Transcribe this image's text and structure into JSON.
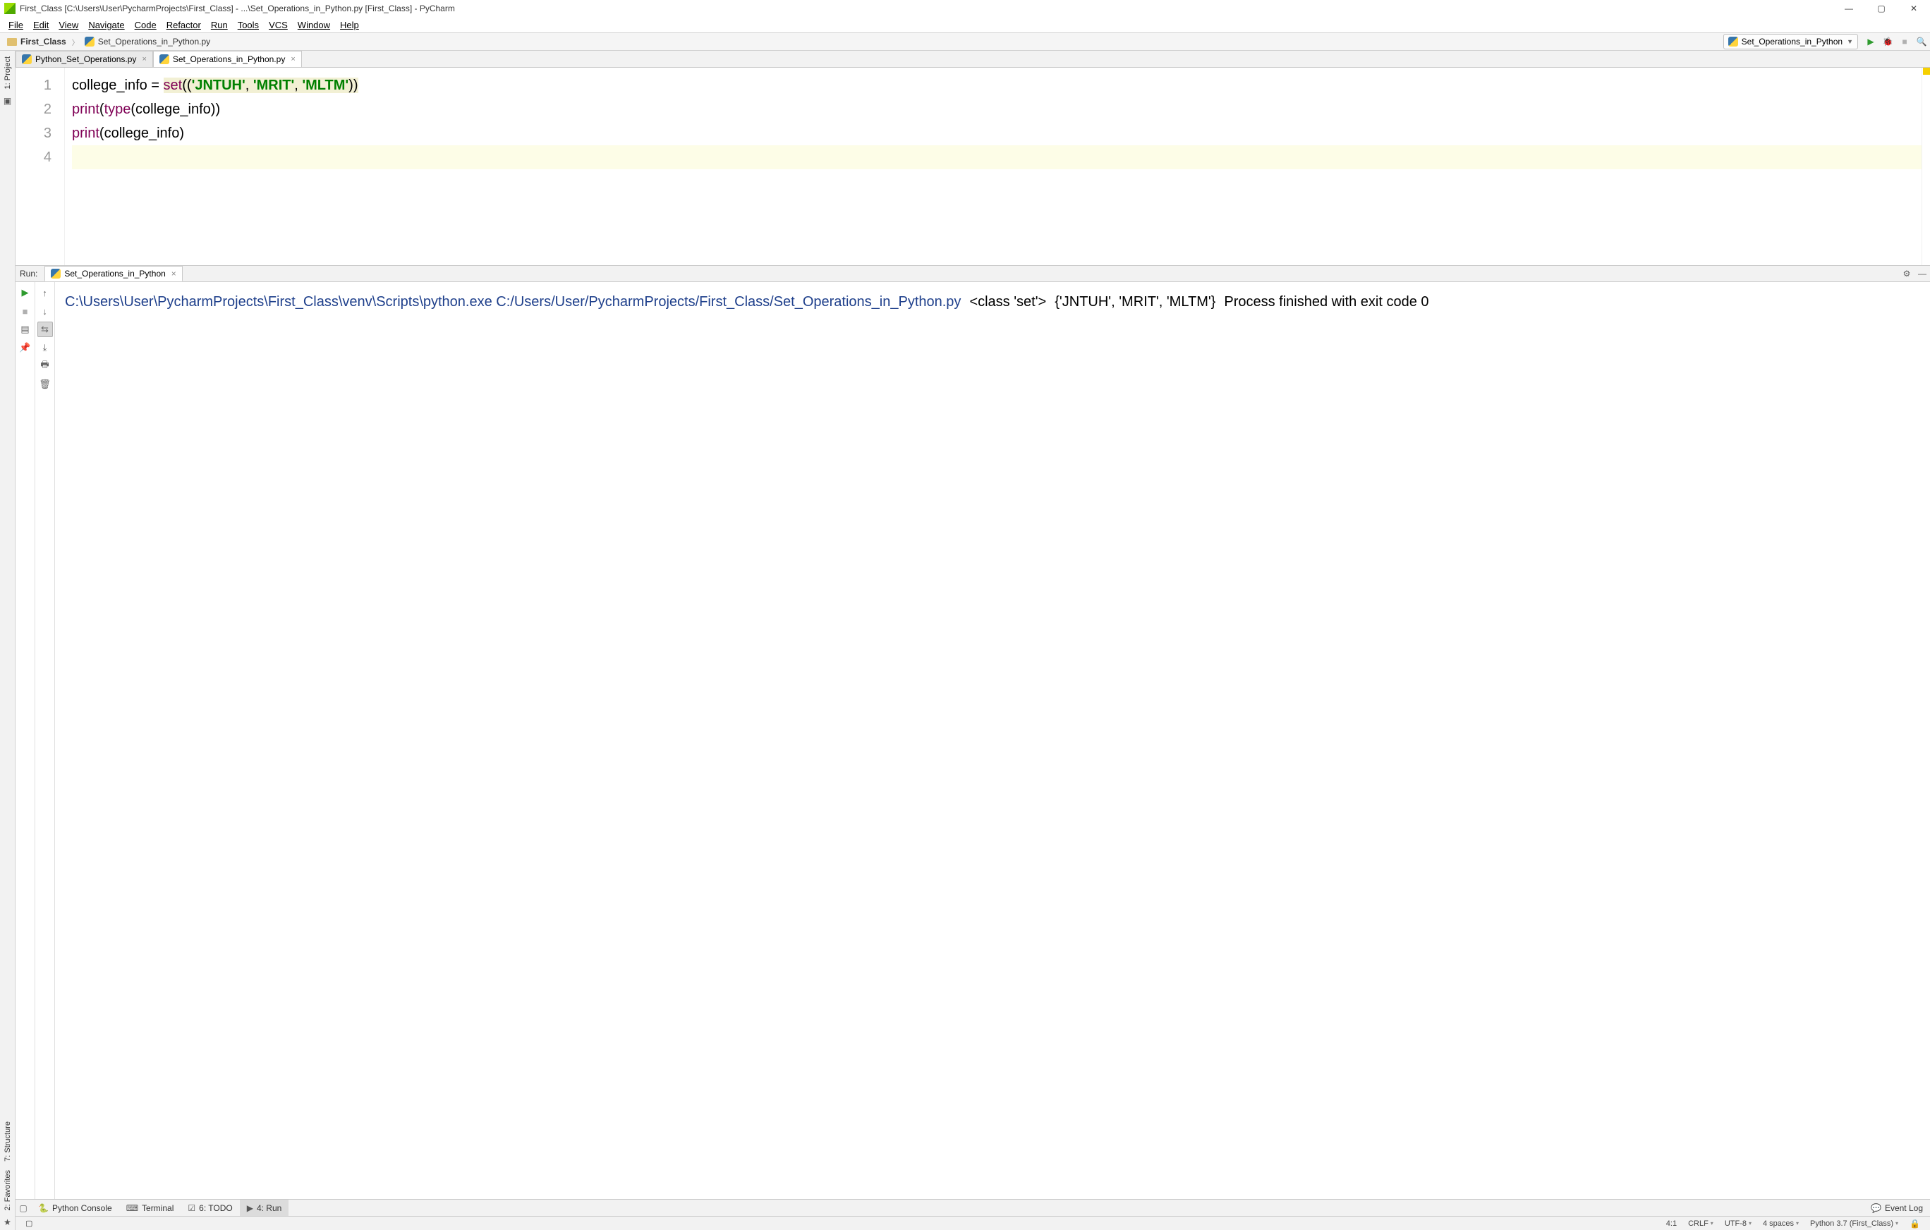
{
  "title": "First_Class [C:\\Users\\User\\PycharmProjects\\First_Class] - ...\\Set_Operations_in_Python.py [First_Class] - PyCharm",
  "menu": [
    "File",
    "Edit",
    "View",
    "Navigate",
    "Code",
    "Refactor",
    "Run",
    "Tools",
    "VCS",
    "Window",
    "Help"
  ],
  "breadcrumbs": {
    "project": "First_Class",
    "file": "Set_Operations_in_Python.py"
  },
  "run_config": "Set_Operations_in_Python",
  "editor_tabs": [
    {
      "label": "Python_Set_Operations.py",
      "active": false
    },
    {
      "label": "Set_Operations_in_Python.py",
      "active": true
    }
  ],
  "sidebar_tools": [
    {
      "label": "1: Project"
    }
  ],
  "left_bottom_tools": [
    "7: Structure",
    "2: Favorites"
  ],
  "code": {
    "lines": [
      "1",
      "2",
      "3",
      "4"
    ],
    "l1_a": "college_info = ",
    "l1_b": "set",
    "l1_c": "((",
    "l1_s1": "'JNTUH'",
    "l1_d": ", ",
    "l1_s2": "'MRIT'",
    "l1_e": ", ",
    "l1_s3": "'MLTM'",
    "l1_f": "))",
    "l2_a": "print",
    "l2_b": "(",
    "l2_c": "type",
    "l2_d": "(college_info))",
    "l3_a": "print",
    "l3_b": "(college_info)"
  },
  "run_panel": {
    "header_label": "Run:",
    "tab_label": "Set_Operations_in_Python"
  },
  "console": {
    "line1": "C:\\Users\\User\\PycharmProjects\\First_Class\\venv\\Scripts\\python.exe ",
    "line2": "C:/Users/User/PycharmProjects/First_Class/Set_Operations_in_Python.py",
    "line3": "<class 'set'>",
    "line4": "{'JNTUH', 'MRIT', 'MLTM'}",
    "line5": "",
    "line6": "Process finished with exit code 0"
  },
  "bottom_tabs": {
    "python_console": "Python Console",
    "terminal": "Terminal",
    "todo": "6: TODO",
    "run": "4: Run",
    "event_log": "Event Log"
  },
  "status": {
    "pos": "4:1",
    "crlf": "CRLF",
    "enc": "UTF-8",
    "indent": "4 spaces",
    "interp": "Python 3.7 (First_Class)"
  }
}
